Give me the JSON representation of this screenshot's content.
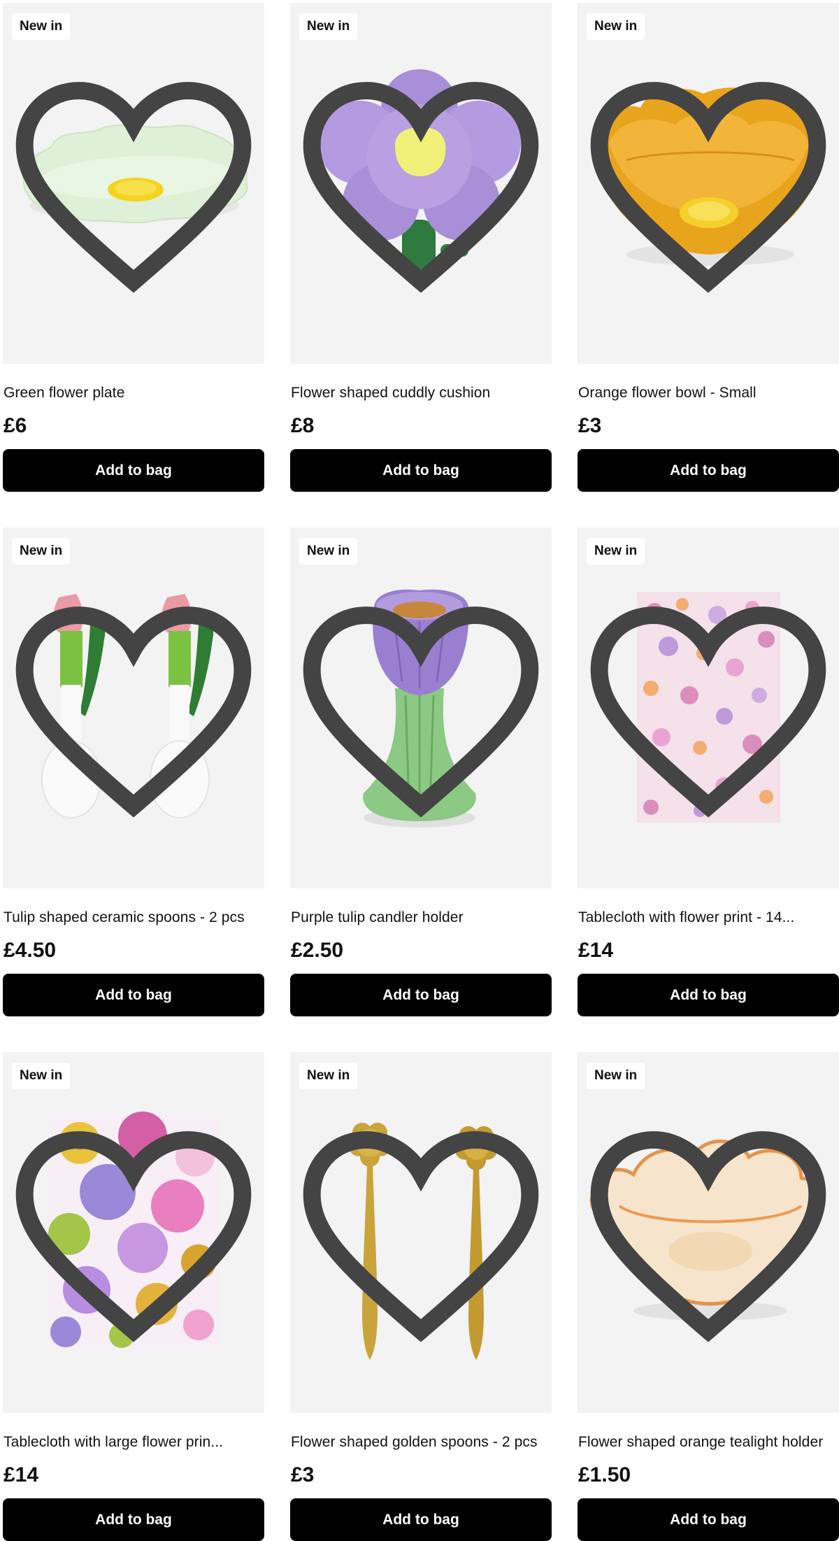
{
  "products": [
    {
      "badge": "New in",
      "title": "Green flower plate",
      "price": "£6",
      "cta": "Add to bag",
      "image": "green-flower-plate"
    },
    {
      "badge": "New in",
      "title": "Flower shaped cuddly cushion",
      "price": "£8",
      "cta": "Add to bag",
      "image": "purple-flower-cushion"
    },
    {
      "badge": "New in",
      "title": "Orange flower bowl - Small",
      "price": "£3",
      "cta": "Add to bag",
      "image": "orange-flower-bowl"
    },
    {
      "badge": "New in",
      "title": "Tulip shaped ceramic spoons - 2 pcs",
      "price": "£4.50",
      "cta": "Add to bag",
      "image": "tulip-ceramic-spoons"
    },
    {
      "badge": "New in",
      "title": "Purple tulip candler holder",
      "price": "£2.50",
      "cta": "Add to bag",
      "image": "purple-tulip-candle-holder"
    },
    {
      "badge": "New in",
      "title": "Tablecloth with flower print - 14...",
      "price": "£14",
      "cta": "Add to bag",
      "image": "floral-tablecloth"
    },
    {
      "badge": "New in",
      "title": "Tablecloth with large flower prin...",
      "price": "£14",
      "cta": "Add to bag",
      "image": "large-floral-tablecloth"
    },
    {
      "badge": "New in",
      "title": "Flower shaped golden spoons - 2 pcs",
      "price": "£3",
      "cta": "Add to bag",
      "image": "golden-flower-spoons"
    },
    {
      "badge": "New in",
      "title": "Flower shaped orange tealight holder",
      "price": "£1.50",
      "cta": "Add to bag",
      "image": "orange-glass-tealight"
    }
  ],
  "icons": {
    "wishlist": "heart-outline-icon"
  },
  "colors": {
    "button": "#000000",
    "button_text": "#ffffff",
    "image_bg": "#f3f3f3"
  }
}
